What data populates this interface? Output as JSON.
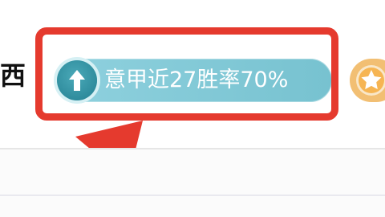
{
  "header": {
    "partial_title": "西"
  },
  "badge": {
    "text": "意甲近27胜率70%",
    "icon": "trend-up-arrow-icon"
  },
  "next_badge": {
    "icon": "star-icon"
  },
  "annotation": {
    "color": "#e53a2e"
  },
  "colors": {
    "badge_bg": "#7fc8d6",
    "badge_icon_bg": "#2f8c9d",
    "next_badge_bg": "#f2bf73"
  }
}
